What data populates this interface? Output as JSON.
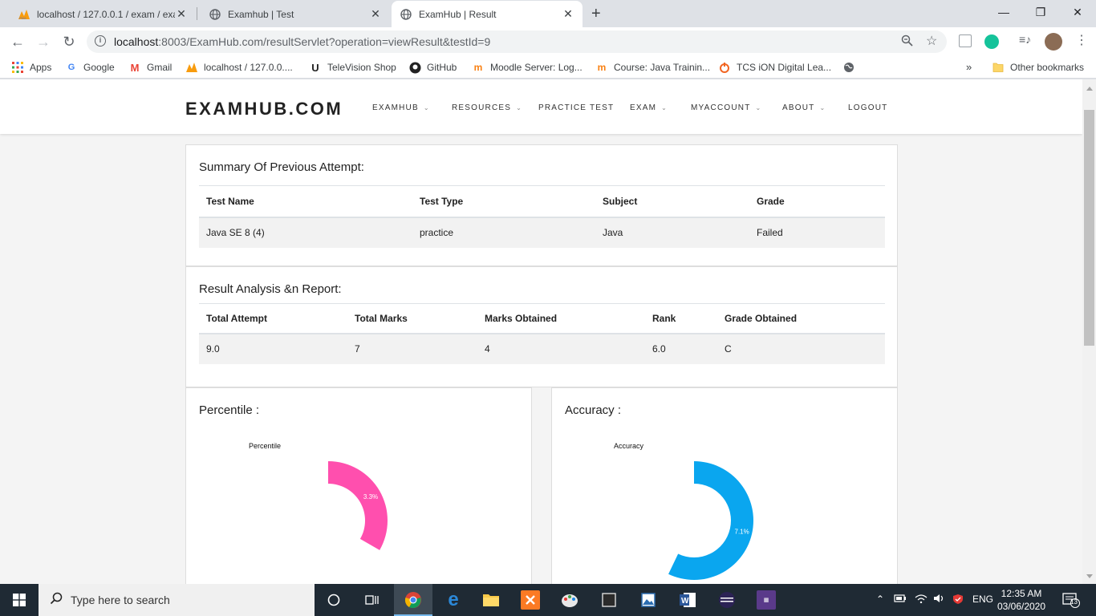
{
  "browser": {
    "tabs": [
      {
        "title": "localhost / 127.0.0.1 / exam / exa",
        "icon": "phpmyadmin-icon"
      },
      {
        "title": "Examhub | Test",
        "icon": "globe-icon"
      },
      {
        "title": "ExamHub | Result",
        "icon": "globe-icon"
      }
    ],
    "url_host": "localhost",
    "url_rest": ":8003/ExamHub.com/resultServlet?operation=viewResult&testId=9",
    "bookmarks": [
      {
        "label": "Apps",
        "icon": "apps-grid-icon"
      },
      {
        "label": "Google",
        "icon": "google-icon"
      },
      {
        "label": "Gmail",
        "icon": "gmail-icon"
      },
      {
        "label": "localhost / 127.0.0....",
        "icon": "phpmyadmin-icon"
      },
      {
        "label": "TeleVision Shop",
        "icon": "television-shop-icon"
      },
      {
        "label": "GitHub",
        "icon": "github-icon"
      },
      {
        "label": "Moodle Server: Log...",
        "icon": "moodle-icon"
      },
      {
        "label": "Course: Java Trainin...",
        "icon": "moodle-icon"
      },
      {
        "label": "TCS iON Digital Lea...",
        "icon": "tcs-ion-icon"
      }
    ],
    "other_bookmarks": "Other bookmarks",
    "more": "»"
  },
  "site": {
    "brand": "EXAMHUB.COM",
    "nav": [
      {
        "label": "EXAMHUB",
        "dropdown": true
      },
      {
        "label": "RESOURCES",
        "dropdown": true
      },
      {
        "label": "PRACTICE TEST",
        "dropdown": false
      },
      {
        "label": "EXAM",
        "dropdown": true
      },
      {
        "label": "MYACCOUNT",
        "dropdown": true
      },
      {
        "label": "ABOUT",
        "dropdown": true
      },
      {
        "label": "LOGOUT",
        "dropdown": false
      }
    ]
  },
  "summary": {
    "heading": "Summary Of Previous Attempt:",
    "headers": [
      "Test Name",
      "Test Type",
      "Subject",
      "Grade"
    ],
    "row": [
      "Java SE 8 (4)",
      "practice",
      "Java",
      "Failed"
    ]
  },
  "analysis": {
    "heading": "Result Analysis &n Report:",
    "headers": [
      "Total Attempt",
      "Total Marks",
      "Marks Obtained",
      "Rank",
      "Grade Obtained"
    ],
    "row": [
      "9.0",
      "7",
      "4",
      "6.0",
      "C"
    ]
  },
  "percentile": {
    "heading": "Percentile :",
    "chart_data": {
      "type": "pie",
      "title": "Percentile",
      "slices": [
        {
          "label": "33.3%",
          "value": 33.3,
          "color": "#ff4fae"
        }
      ],
      "shown_label": "3.3%"
    }
  },
  "accuracy": {
    "heading": "Accuracy :",
    "chart_data": {
      "type": "pie",
      "title": "Accuracy",
      "slices": [
        {
          "label": "57.1%",
          "value": 57.1,
          "color": "#0aa6ef"
        }
      ],
      "shown_label": "7.1%"
    }
  },
  "taskbar": {
    "search_placeholder": "Type here to search",
    "language": "ENG",
    "time": "12:35 AM",
    "date": "03/06/2020",
    "notifications": "13"
  }
}
